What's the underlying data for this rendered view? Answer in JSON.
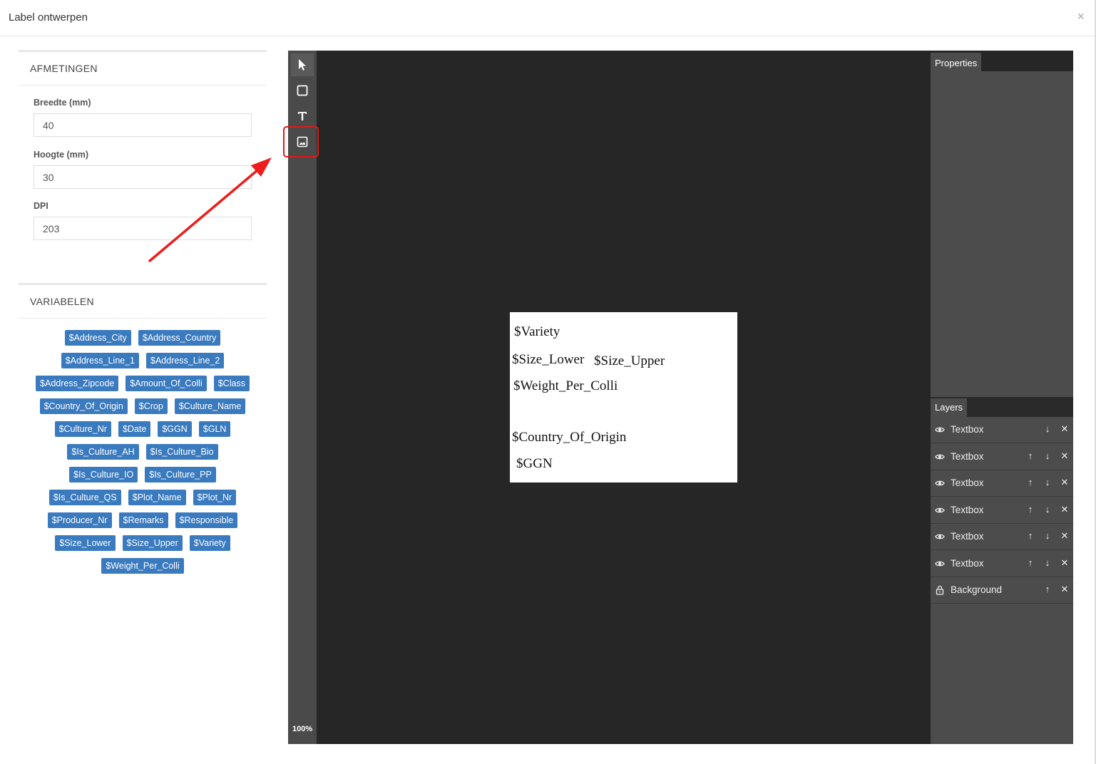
{
  "modal": {
    "title": "Label ontwerpen",
    "close": "×"
  },
  "dimensions": {
    "heading": "AFMETINGEN",
    "width_label": "Breedte (mm)",
    "width_value": "40",
    "height_label": "Hoogte (mm)",
    "height_value": "30",
    "dpi_label": "DPI",
    "dpi_value": "203"
  },
  "variables": {
    "heading": "VARIABELEN",
    "rows": [
      [
        "$Address_City",
        "$Address_Country"
      ],
      [
        "$Address_Line_1",
        "$Address_Line_2"
      ],
      [
        "$Address_Zipcode",
        "$Amount_Of_Colli",
        "$Class"
      ],
      [
        "$Country_Of_Origin",
        "$Crop",
        "$Culture_Name"
      ],
      [
        "$Culture_Nr",
        "$Date",
        "$GGN",
        "$GLN"
      ],
      [
        "$Is_Culture_AH",
        "$Is_Culture_Bio"
      ],
      [
        "$Is_Culture_IO",
        "$Is_Culture_PP"
      ],
      [
        "$Is_Culture_QS",
        "$Plot_Name",
        "$Plot_Nr"
      ],
      [
        "$Producer_Nr",
        "$Remarks",
        "$Responsible"
      ],
      [
        "$Size_Lower",
        "$Size_Upper",
        "$Variety"
      ],
      [
        "$Weight_Per_Colli"
      ]
    ]
  },
  "editor": {
    "zoom": "100%",
    "tools": [
      "select-tool",
      "rectangle-tool",
      "text-tool",
      "image-tool"
    ],
    "canvas_texts": {
      "variety": "$Variety",
      "size_lower": "$Size_Lower",
      "size_upper": "$Size_Upper",
      "weight": "$Weight_Per_Colli",
      "country": "$Country_Of_Origin",
      "ggn": "$GGN"
    },
    "properties_tab": "Properties",
    "layers_tab": "Layers",
    "layers": [
      {
        "name": "Textbox",
        "icon": "eye-icon",
        "up": false,
        "down": true
      },
      {
        "name": "Textbox",
        "icon": "eye-icon",
        "up": true,
        "down": true
      },
      {
        "name": "Textbox",
        "icon": "eye-icon",
        "up": true,
        "down": true
      },
      {
        "name": "Textbox",
        "icon": "eye-icon",
        "up": true,
        "down": true
      },
      {
        "name": "Textbox",
        "icon": "eye-icon",
        "up": true,
        "down": true
      },
      {
        "name": "Textbox",
        "icon": "eye-icon",
        "up": true,
        "down": true
      },
      {
        "name": "Background",
        "icon": "lock-icon",
        "up": true,
        "down": false
      }
    ]
  },
  "colors": {
    "chip": "#3a7abf",
    "editor_bg": "#262626",
    "toolbar": "#4a4a4a",
    "highlight": "#e01818"
  }
}
